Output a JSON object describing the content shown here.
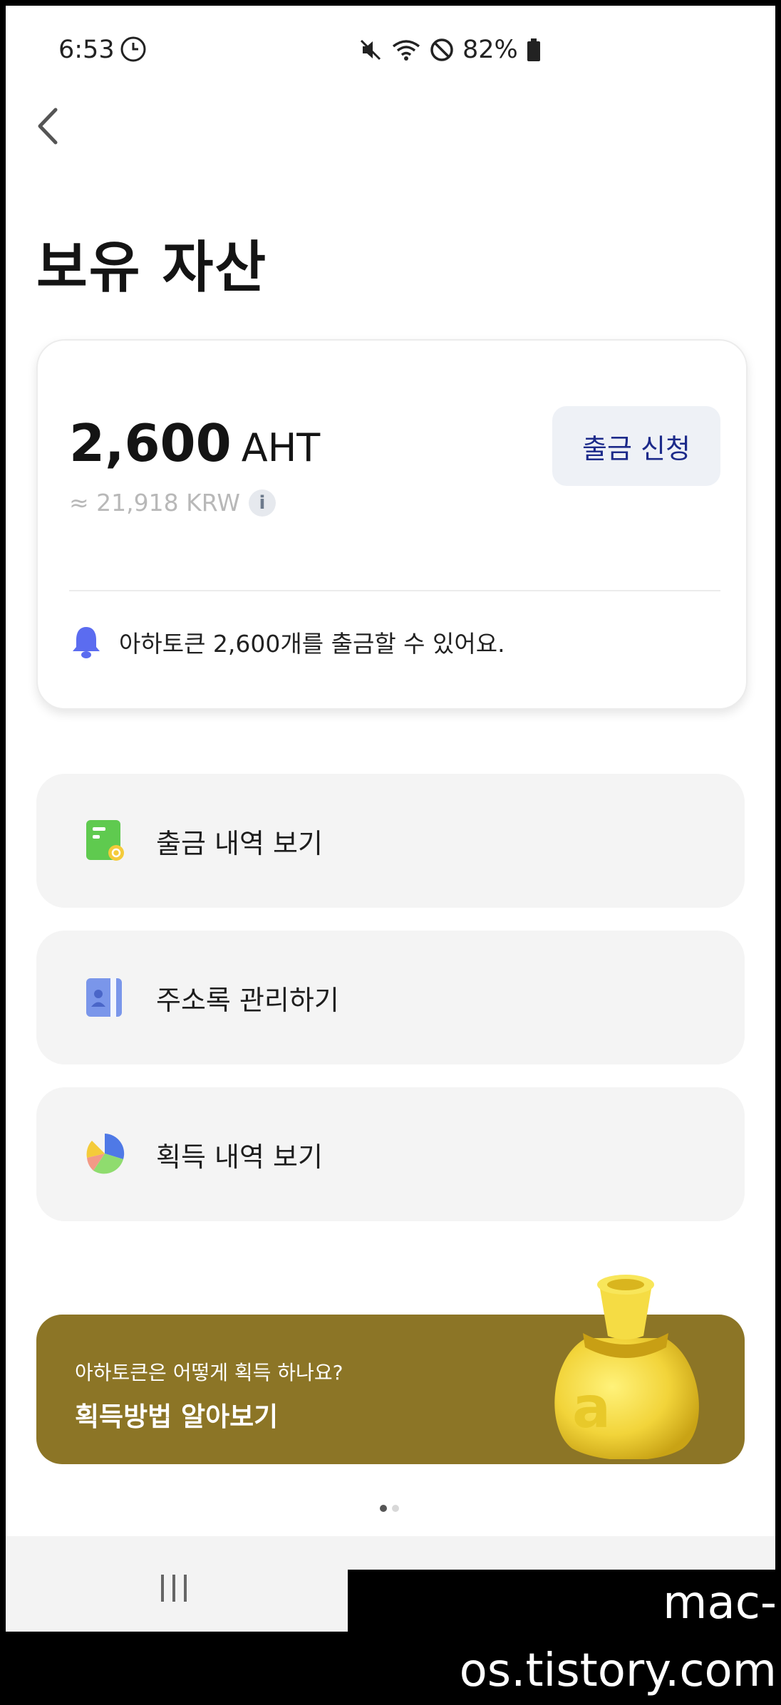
{
  "status_bar": {
    "time": "6:53",
    "battery": "82%"
  },
  "page_title": "보유 자산",
  "balance": {
    "amount": "2,600",
    "unit": "AHT",
    "krw_value": "≈ 21,918 KRW",
    "withdraw_button": "출금 신청",
    "notice": "아하토큰 2,600개를 출금할 수 있어요."
  },
  "menu": [
    {
      "label": "출금 내역 보기",
      "icon": "withdraw-history-icon"
    },
    {
      "label": "주소록 관리하기",
      "icon": "address-book-icon"
    },
    {
      "label": "획득 내역 보기",
      "icon": "pie-chart-icon"
    }
  ],
  "banner": {
    "subtitle": "아하토큰은 어떻게 획득 하나요?",
    "title": "획득방법 알아보기"
  },
  "watermark": "mac-os.tistory.com",
  "colors": {
    "banner": "#8c7526",
    "withdraw_button_text": "#1c2a8a",
    "notice_bell": "#5b6cf0"
  }
}
